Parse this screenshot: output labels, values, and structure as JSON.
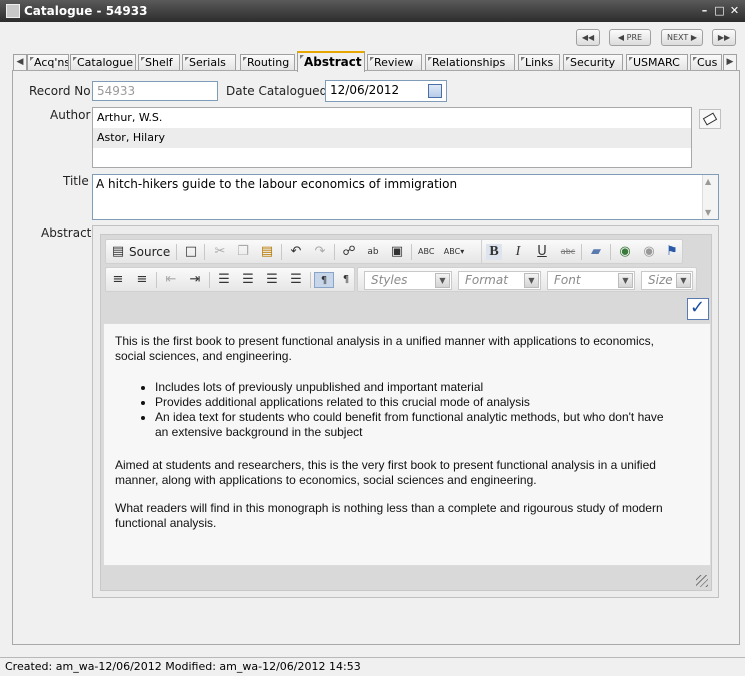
{
  "window": {
    "title": "Catalogue - 54933"
  },
  "nav": {
    "first": "◀◀",
    "prev": "PRE",
    "next": "NEXT",
    "last": "▶▶"
  },
  "tabs": [
    "Acq'ns",
    "Catalogue",
    "Shelf",
    "Serials",
    "Routing",
    "Abstract",
    "Review",
    "Relationships",
    "Links",
    "Security",
    "USMARC",
    "Cus"
  ],
  "active_tab": "Abstract",
  "form": {
    "record_no_label": "Record No",
    "record_no_value": "54933",
    "date_label": "Date Catalogued",
    "date_value": "12/06/2012",
    "author_label": "Author",
    "authors": [
      "Arthur, W.S.",
      "Astor, Hilary"
    ],
    "title_label": "Title",
    "title_value": "A hitch-hikers guide to the labour economics of immigration",
    "abstract_label": "Abstract"
  },
  "editor": {
    "source_label": "Source",
    "styles_placeholder": "Styles",
    "format_placeholder": "Format",
    "font_placeholder": "Font",
    "size_placeholder": "Size",
    "content": {
      "para1": "This is the first book to present functional analysis in a unified manner with applications to economics, social sciences, and engineering.",
      "bullets": [
        "Includes lots of previously unpublished and important material",
        "Provides additional applications related to this crucial mode of analysis",
        " An idea text for students who could benefit from functional analytic methods, but who don't have an extensive background in the subject"
      ],
      "para2": "Aimed at students and researchers, this is the very first book to present functional analysis in a unified manner, along with applications to economics, social sciences and engineering.",
      "para3": "What readers will find in this monograph is nothing less than a complete and rigourous study of modern functional analysis."
    }
  },
  "status": {
    "text": "Created: am_wa-12/06/2012 Modified: am_wa-12/06/2012 14:53"
  },
  "colors": {
    "active_tab_accent": "#e8a700",
    "field_border": "#7f9db9",
    "confirm_blue": "#1a4fa0"
  }
}
